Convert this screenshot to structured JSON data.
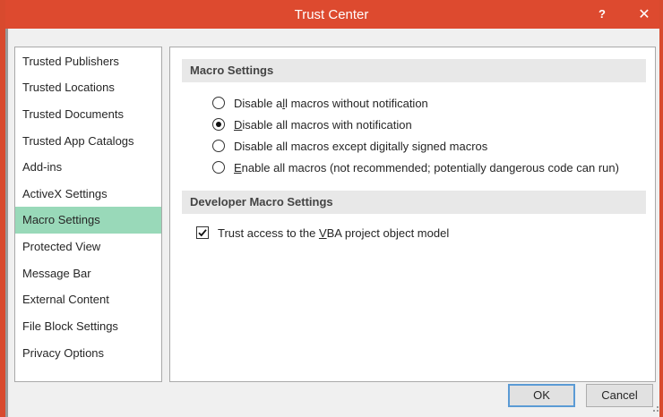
{
  "window": {
    "title": "Trust Center",
    "help_label": "?",
    "close_label": "✕",
    "accent_color": "#dd4a2f"
  },
  "sidebar": {
    "items": [
      {
        "label": "Trusted Publishers"
      },
      {
        "label": "Trusted Locations"
      },
      {
        "label": "Trusted Documents"
      },
      {
        "label": "Trusted App Catalogs"
      },
      {
        "label": "Add-ins"
      },
      {
        "label": "ActiveX Settings"
      },
      {
        "label": "Macro Settings",
        "selected": true
      },
      {
        "label": "Protected View"
      },
      {
        "label": "Message Bar"
      },
      {
        "label": "External Content"
      },
      {
        "label": "File Block Settings"
      },
      {
        "label": "Privacy Options"
      }
    ],
    "selected_color": "#99d9b9"
  },
  "macro_settings": {
    "header": "Macro Settings",
    "options": [
      {
        "pre": "Disable a",
        "key": "l",
        "post": "l macros without notification",
        "checked": false
      },
      {
        "pre": "",
        "key": "D",
        "post": "isable all macros with notification",
        "checked": true
      },
      {
        "pre": "Disable all macros except di",
        "key": "g",
        "post": "itally signed macros",
        "checked": false
      },
      {
        "pre": "",
        "key": "E",
        "post": "nable all macros (not recommended; potentially dangerous code can run)",
        "checked": false
      }
    ]
  },
  "developer_settings": {
    "header": "Developer Macro Settings",
    "trust_vba": {
      "pre": "Trust access to the ",
      "key": "V",
      "post": "BA project object model",
      "checked": true
    }
  },
  "buttons": {
    "ok": "OK",
    "cancel": "Cancel"
  }
}
